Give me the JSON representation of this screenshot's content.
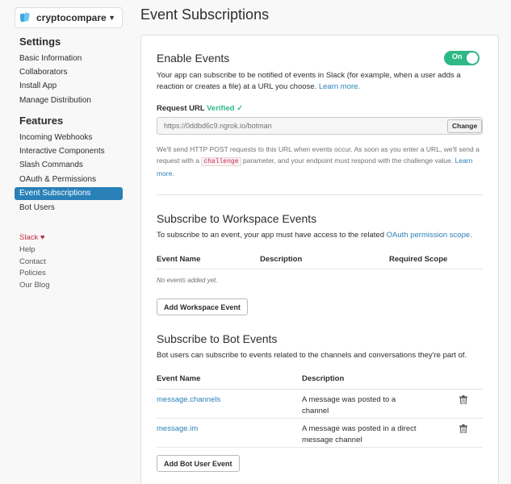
{
  "sidebar": {
    "app_name": "cryptocompare",
    "settings_heading": "Settings",
    "settings_items": [
      "Basic Information",
      "Collaborators",
      "Install App",
      "Manage Distribution"
    ],
    "features_heading": "Features",
    "features_items": [
      "Incoming Webhooks",
      "Interactive Components",
      "Slash Commands",
      "OAuth & Permissions",
      "Event Subscriptions",
      "Bot Users"
    ],
    "active_item": "Event Subscriptions",
    "footer_links": [
      "Slack",
      "Help",
      "Contact",
      "Policies",
      "Our Blog"
    ],
    "slack_heart": "♥"
  },
  "page": {
    "title": "Event Subscriptions"
  },
  "enable_events": {
    "heading": "Enable Events",
    "toggle_label": "On",
    "description": "Your app can subscribe to be notified of events in Slack (for example, when a user adds a reaction or creates a file) at a URL you choose.",
    "learn_more": "Learn more.",
    "request_url_label": "Request URL",
    "verified_label": "Verified",
    "check": "✓",
    "request_url_value": "https://0ddbd6c9.ngrok.io/botman",
    "change_button": "Change",
    "help_part1": "We'll send HTTP POST requests to this URL when events occur. As soon as you enter a URL, we'll send a request with a",
    "help_code": "challenge",
    "help_part2": "parameter, and your endpoint must respond with the challenge value.",
    "help_learn_more": "Learn more."
  },
  "workspace_events": {
    "heading": "Subscribe to Workspace Events",
    "description": "To subscribe to an event, your app must have access to the related",
    "scope_link": "OAuth permission scope.",
    "col_event_name": "Event Name",
    "col_description": "Description",
    "col_required_scope": "Required Scope",
    "empty_text": "No events added yet.",
    "add_button": "Add Workspace Event"
  },
  "bot_events": {
    "heading": "Subscribe to Bot Events",
    "description": "Bot users can subscribe to events related to the channels and conversations they're part of.",
    "col_event_name": "Event Name",
    "col_description": "Description",
    "rows": [
      {
        "name": "message.channels",
        "description_line1": "A message was posted to a",
        "description_line2": "channel"
      },
      {
        "name": "message.im",
        "description_line1": "A message was posted in a direct",
        "description_line2": "message channel"
      }
    ],
    "add_button": "Add Bot User Event"
  }
}
